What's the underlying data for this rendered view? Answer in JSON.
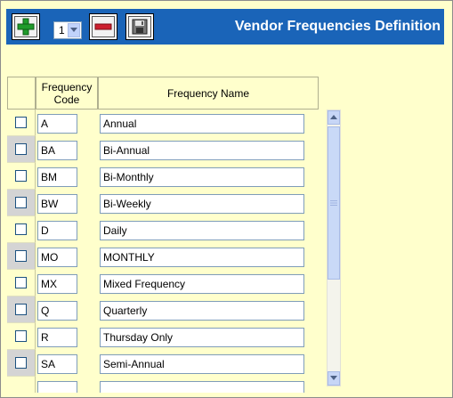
{
  "header": {
    "title": "Vendor Frequencies Definition",
    "page_select_value": "1"
  },
  "grid": {
    "columns": [
      "Frequency Code",
      "Frequency Name"
    ],
    "rows": [
      {
        "code": "A",
        "name": "Annual"
      },
      {
        "code": "BA",
        "name": "Bi-Annual"
      },
      {
        "code": "BM",
        "name": "Bi-Monthly"
      },
      {
        "code": "BW",
        "name": "Bi-Weekly"
      },
      {
        "code": "D",
        "name": "Daily"
      },
      {
        "code": "MO",
        "name": "MONTHLY"
      },
      {
        "code": "MX",
        "name": "Mixed Frequency"
      },
      {
        "code": "Q",
        "name": "Quarterly"
      },
      {
        "code": "R",
        "name": "Thursday Only"
      },
      {
        "code": "SA",
        "name": "Semi-Annual"
      }
    ]
  },
  "icons": {
    "add": "plus-icon",
    "remove": "minus-icon",
    "save": "floppy-disk-icon"
  },
  "colors": {
    "header_bg": "#1a64b8",
    "page_bg": "#ffffcc",
    "add_green": "#1f9b2b",
    "remove_red": "#cc1f2f"
  }
}
